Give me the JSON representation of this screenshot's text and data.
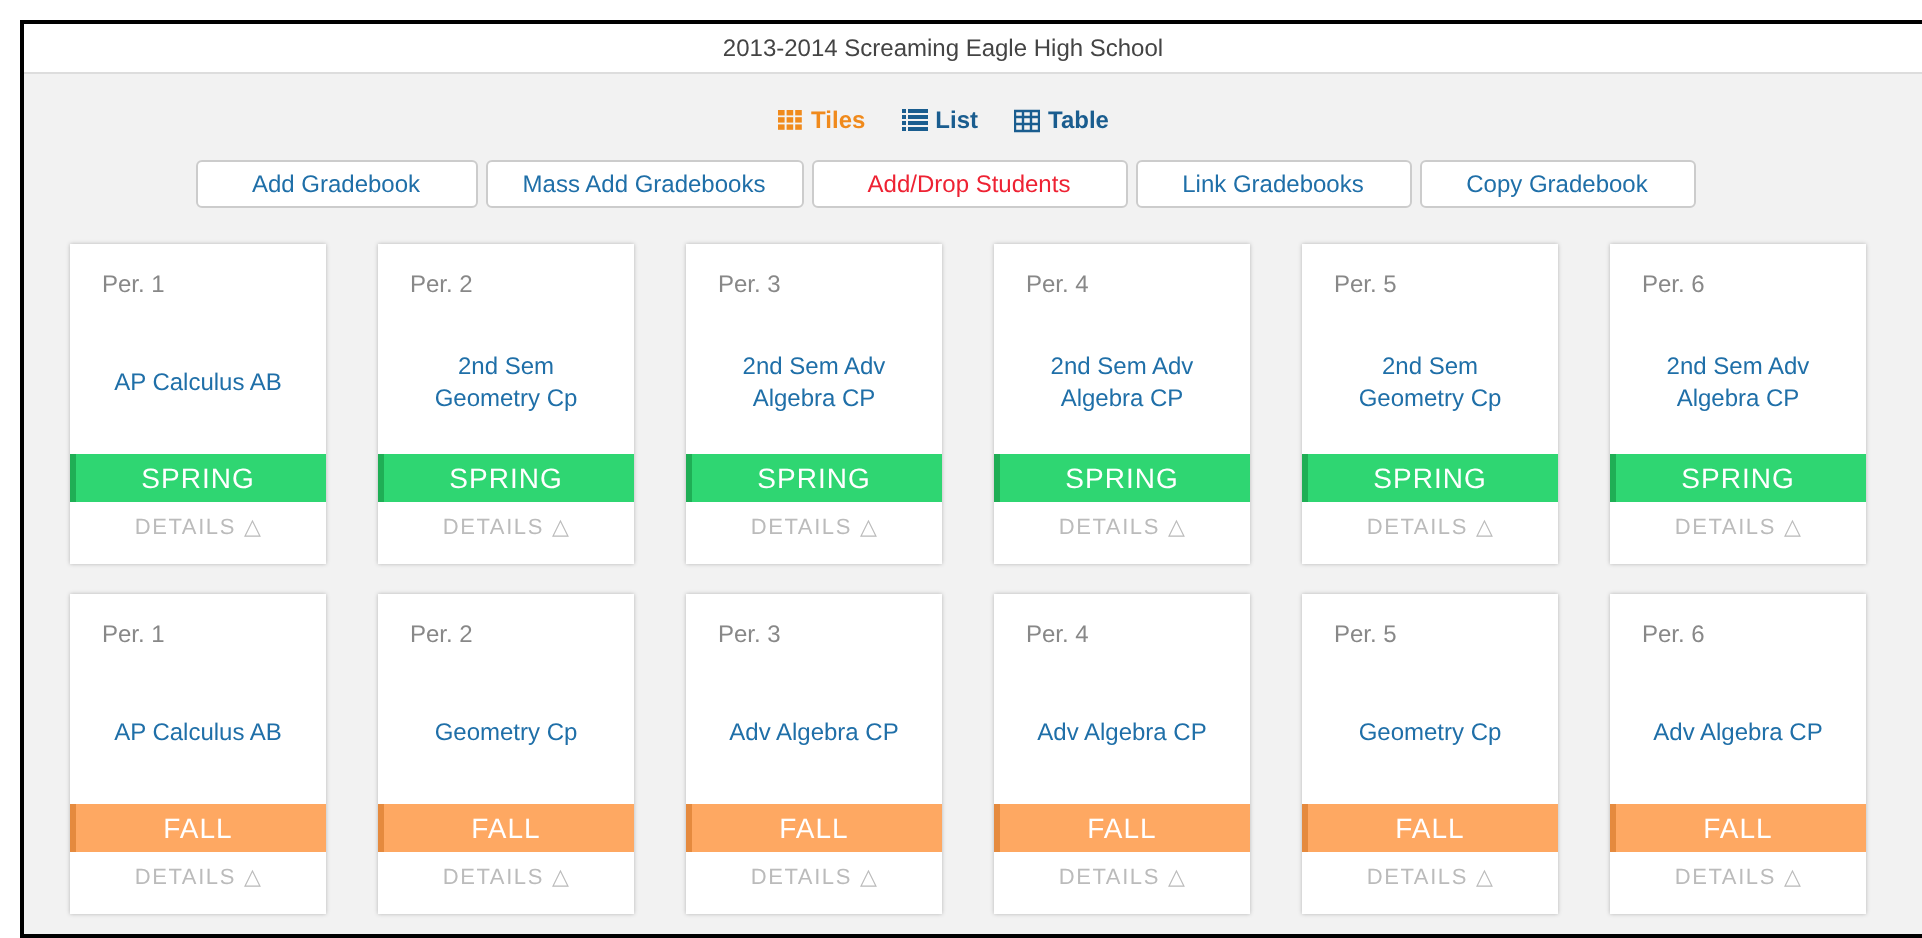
{
  "header": {
    "title": "2013-2014 Screaming Eagle High School"
  },
  "views": [
    {
      "label": "Tiles",
      "kind": "tiles",
      "selected": true
    },
    {
      "label": "List",
      "kind": "list",
      "selected": false
    },
    {
      "label": "Table",
      "kind": "table",
      "selected": false
    }
  ],
  "actions": [
    {
      "label": "Add Gradebook",
      "kind": "default"
    },
    {
      "label": "Mass Add Gradebooks",
      "kind": "default"
    },
    {
      "label": "Add/Drop Students",
      "kind": "alert"
    },
    {
      "label": "Link Gradebooks",
      "kind": "default"
    },
    {
      "label": "Copy Gradebook",
      "kind": "default"
    }
  ],
  "rows": [
    [
      {
        "period": "Per. 1",
        "course": "AP Calculus AB",
        "term": "SPRING",
        "kind": "spring",
        "details": "DETAILS △"
      },
      {
        "period": "Per. 2",
        "course": "2nd Sem Geometry Cp",
        "term": "SPRING",
        "kind": "spring",
        "details": "DETAILS △"
      },
      {
        "period": "Per. 3",
        "course": "2nd Sem Adv Algebra CP",
        "term": "SPRING",
        "kind": "spring",
        "details": "DETAILS △"
      },
      {
        "period": "Per. 4",
        "course": "2nd Sem Adv Algebra CP",
        "term": "SPRING",
        "kind": "spring",
        "details": "DETAILS △"
      },
      {
        "period": "Per. 5",
        "course": "2nd Sem Geometry Cp",
        "term": "SPRING",
        "kind": "spring",
        "details": "DETAILS △"
      },
      {
        "period": "Per. 6",
        "course": "2nd Sem Adv Algebra CP",
        "term": "SPRING",
        "kind": "spring",
        "details": "DETAILS △"
      }
    ],
    [
      {
        "period": "Per. 1",
        "course": "AP Calculus AB",
        "term": "FALL",
        "kind": "fall",
        "details": "DETAILS △"
      },
      {
        "period": "Per. 2",
        "course": "Geometry Cp",
        "term": "FALL",
        "kind": "fall",
        "details": "DETAILS △"
      },
      {
        "period": "Per. 3",
        "course": "Adv Algebra CP",
        "term": "FALL",
        "kind": "fall",
        "details": "DETAILS △"
      },
      {
        "period": "Per. 4",
        "course": "Adv Algebra CP",
        "term": "FALL",
        "kind": "fall",
        "details": "DETAILS △"
      },
      {
        "period": "Per. 5",
        "course": "Geometry Cp",
        "term": "FALL",
        "kind": "fall",
        "details": "DETAILS △"
      },
      {
        "period": "Per. 6",
        "course": "Adv Algebra CP",
        "term": "FALL",
        "kind": "fall",
        "details": "DETAILS △"
      }
    ]
  ]
}
